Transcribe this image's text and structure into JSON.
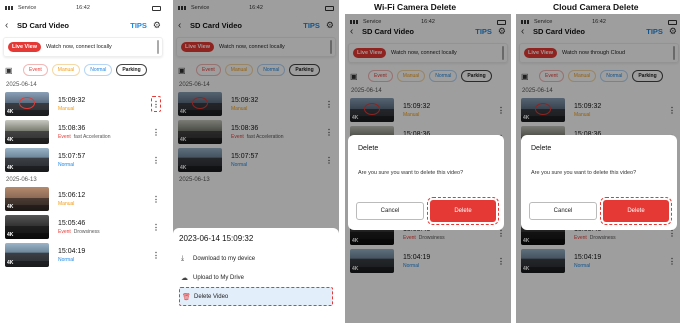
{
  "captions": {
    "wifi": "Wi-Fi Camera Delete",
    "cloud": "Cloud Camera Delete"
  },
  "status": {
    "carrier": "Service",
    "time": "16:42"
  },
  "nav": {
    "title": "SD Card Video",
    "tips": "TIPS"
  },
  "live": {
    "button": "Live View",
    "msg_local": "Watch now, connect locally",
    "msg_cloud": "Watch now through Cloud"
  },
  "filters": [
    "Event",
    "Manual",
    "Normal",
    "Parking"
  ],
  "dates": [
    "2025-06-14",
    "2025-06-13"
  ],
  "rows": [
    {
      "time": "15:09:32",
      "tag": "Manual",
      "sub": ""
    },
    {
      "time": "15:08:36",
      "tag": "Event",
      "sub": "fast Acceleration"
    },
    {
      "time": "15:07:57",
      "tag": "Normal",
      "sub": ""
    },
    {
      "time": "15:06:12",
      "tag": "Manual",
      "sub": ""
    },
    {
      "time": "15:05:46",
      "tag": "Event",
      "sub": "Drowsiness"
    },
    {
      "time": "15:04:19",
      "tag": "Normal",
      "sub": ""
    }
  ],
  "badge": "4K",
  "sheet": {
    "title": "2023-06-14 15:09:32",
    "download": "Download to my device",
    "upload": "Upload to My Drive",
    "delete": "Delete Video"
  },
  "dialog": {
    "title": "Delete",
    "message": "Are you sure you want to delete this video?",
    "cancel": "Cancel",
    "confirm": "Delete"
  },
  "colors": {
    "accent": "#e53935",
    "tips": "#1e88e5",
    "manual": "#f39c12"
  }
}
